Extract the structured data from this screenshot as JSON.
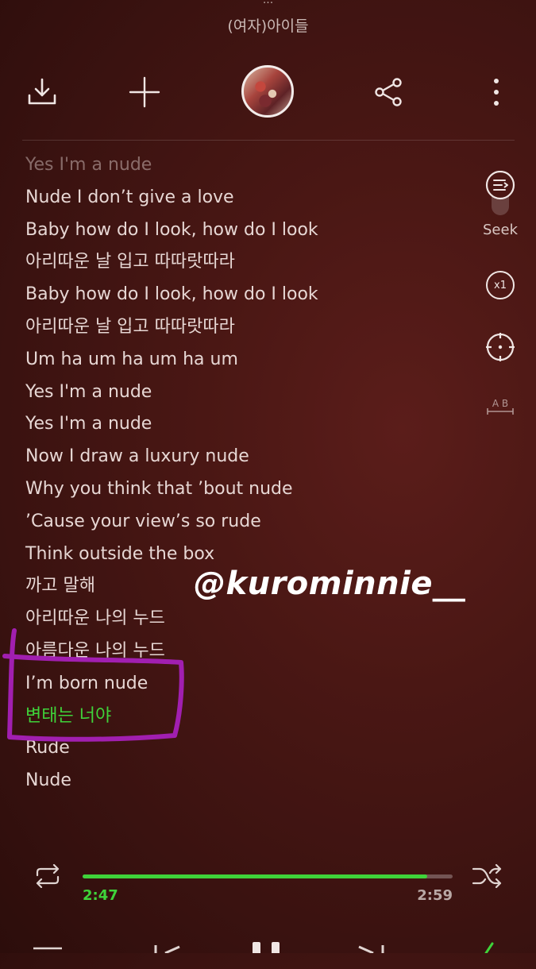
{
  "header": {
    "top_clipped_text": "...",
    "artist": "(여자)아이들"
  },
  "toolbar": {
    "buttons": [
      "download-icon",
      "add-icon",
      "album-art",
      "share-icon",
      "more-icon"
    ]
  },
  "lyrics": [
    "Yes I'm a nude",
    "Nude I don’t give a love",
    "Baby how do I look, how do I look",
    "아리따운 날 입고 따따랏따라",
    "Baby how do I look, how do I look",
    "아리따운 날 입고 따따랏따라",
    "Um ha um ha um ha um",
    "Yes I'm a nude",
    "Yes I'm a nude",
    "Now I draw a luxury nude",
    "Why you think that ’bout nude",
    "’Cause your view’s so rude",
    "Think outside the box",
    "까고 말해",
    "아리따운 나의 누드",
    "아름다운 나의 누드",
    "I’m born nude",
    "변태는 너야",
    "Rude",
    "Nude"
  ],
  "active_line_index": 17,
  "side_controls": {
    "seek_label": "Seek",
    "speed_label": "x1",
    "ab_label": "A B"
  },
  "watermark": "@kurominnie__",
  "player": {
    "current_time": "2:47",
    "total_time": "2:59",
    "progress_fraction": 0.932
  },
  "colors": {
    "accent": "#3fd33a",
    "annotation": "#a11fb0",
    "background": "#4a1714"
  }
}
